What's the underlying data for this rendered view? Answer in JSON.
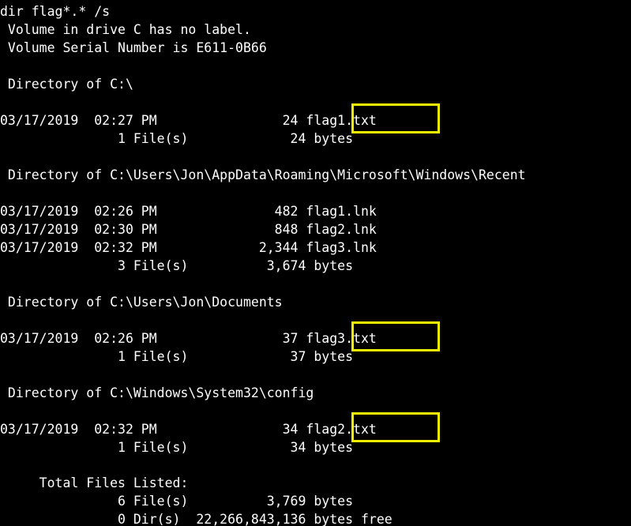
{
  "terminal": {
    "lines": [
      "dir flag*.* /s",
      " Volume in drive C has no label.",
      " Volume Serial Number is E611-0B66",
      "",
      " Directory of C:\\",
      "",
      "03/17/2019  02:27 PM                24 flag1.txt",
      "               1 File(s)             24 bytes",
      "",
      " Directory of C:\\Users\\Jon\\AppData\\Roaming\\Microsoft\\Windows\\Recent",
      "",
      "03/17/2019  02:26 PM               482 flag1.lnk",
      "03/17/2019  02:30 PM               848 flag2.lnk",
      "03/17/2019  02:32 PM             2,344 flag3.lnk",
      "               3 File(s)          3,674 bytes",
      "",
      " Directory of C:\\Users\\Jon\\Documents",
      "",
      "03/17/2019  02:26 PM                37 flag3.txt",
      "               1 File(s)             37 bytes",
      "",
      " Directory of C:\\Windows\\System32\\config",
      "",
      "03/17/2019  02:32 PM                34 flag2.txt",
      "               1 File(s)             34 bytes",
      "",
      "     Total Files Listed:",
      "               6 File(s)          3,769 bytes",
      "               0 Dir(s)  22,266,843,136 bytes free"
    ]
  },
  "highlight_color": "#f2f200",
  "highlighted_files": [
    "flag1.txt",
    "flag3.txt",
    "flag2.txt"
  ]
}
